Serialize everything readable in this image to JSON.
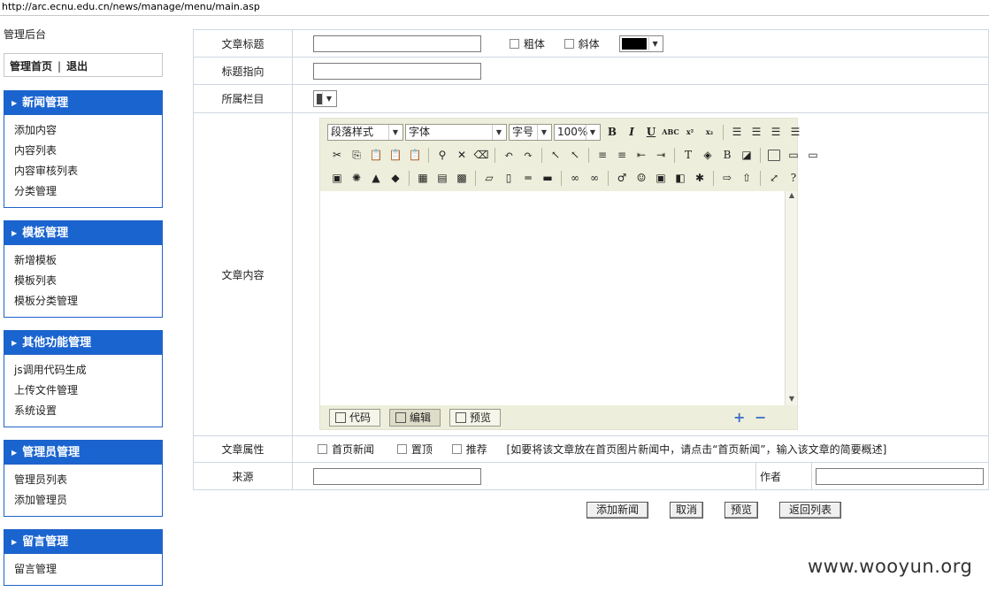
{
  "url": "http://arc.ecnu.edu.cn/news/manage/menu/main.asp",
  "sidebar": {
    "title": "管理后台",
    "home_label": "管理首页",
    "sep": "|",
    "logout_label": "退出",
    "menus": [
      {
        "title": "新闻管理",
        "items": [
          "添加内容",
          "内容列表",
          "内容审核列表",
          "分类管理"
        ]
      },
      {
        "title": "模板管理",
        "items": [
          "新增模板",
          "模板列表",
          "模板分类管理"
        ]
      },
      {
        "title": "其他功能管理",
        "items": [
          "js调用代码生成",
          "上传文件管理",
          "系统设置"
        ]
      },
      {
        "title": "管理员管理",
        "items": [
          "管理员列表",
          "添加管理员"
        ]
      },
      {
        "title": "留言管理",
        "items": [
          "留言管理"
        ]
      }
    ]
  },
  "form": {
    "title_label": "文章标题",
    "title_value": "",
    "bold_label": "粗体",
    "italic_label": "斜体",
    "title_color": "#000000",
    "link_label": "标题指向",
    "link_value": "",
    "category_label": "所属栏目",
    "content_label": "文章内容",
    "attr_label": "文章属性",
    "attr_home": "首页新闻",
    "attr_top": "置顶",
    "attr_recommend": "推荐",
    "attr_note": "[如要将该文章放在首页图片新闻中，请点击“首页新闻”，输入该文章的简要概述]",
    "source_label": "来源",
    "source_value": "",
    "author_label": "作者",
    "author_value": ""
  },
  "editor": {
    "paragraph_style": "段落样式",
    "font": "字体",
    "font_size": "字号",
    "zoom": "100%",
    "bold": "B",
    "italic": "I",
    "underline": "U",
    "strike": "ABC",
    "superscript": "x²",
    "subscript": "x₂",
    "mode_code": "代码",
    "mode_edit": "编辑",
    "mode_preview": "预览",
    "zoom_in": "+",
    "zoom_out": "−"
  },
  "actions": {
    "add": "添加新闻",
    "cancel": "取消",
    "preview": "预览",
    "back": "返回列表"
  },
  "watermark": "www.wooyun.org"
}
